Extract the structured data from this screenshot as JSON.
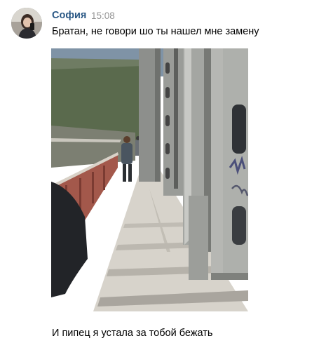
{
  "message": {
    "author": "София",
    "time": "15:08",
    "text": "Братан, не говори шо ты нашел мне замену",
    "caption": "И пипец я устала за тобой бежать"
  },
  "avatar": {
    "icon": "user-avatar-photo"
  },
  "photo": {
    "description_icon": "bridge-photo"
  },
  "colors": {
    "author_link": "#2a5885",
    "timestamp": "#939393",
    "text": "#000000"
  }
}
